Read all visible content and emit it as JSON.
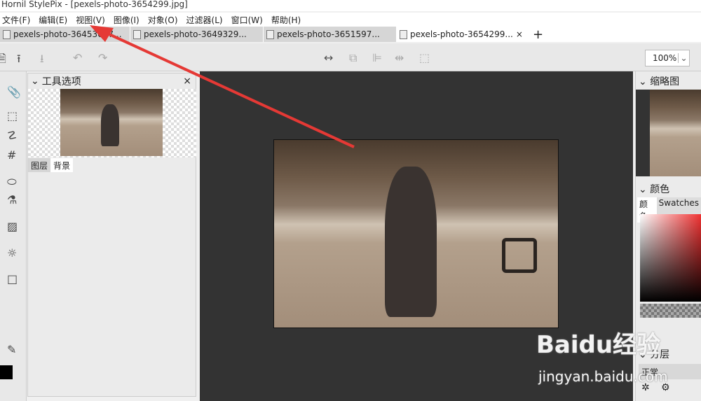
{
  "window_title": "Hornil StylePix - [pexels-photo-3654299.jpg]",
  "menu": [
    "文件(F)",
    "编辑(E)",
    "视图(V)",
    "图像(I)",
    "对象(O)",
    "过滤器(L)",
    "窗口(W)",
    "帮助(H)"
  ],
  "tabs": [
    "pexels-photo-36453697...",
    "pexels-photo-3649329...",
    "pexels-photo-3651597...",
    "pexels-photo-3654299..."
  ],
  "tab_close": "×",
  "tab_add": "+",
  "zoom_value": "100%",
  "tool_options": {
    "title": "工具选项",
    "close": "×",
    "tabs": [
      "图层",
      "背景"
    ]
  },
  "right": {
    "navigator": "缩略图",
    "color": "颜色",
    "color_tabs": [
      "颜色",
      "Swatches"
    ],
    "layers": "分层",
    "blend_mode": "正常"
  },
  "watermark": {
    "brand": "Baidu经验",
    "url": "jingyan.baidu.com"
  },
  "colors": {
    "canvas_bg": "#333333",
    "arrow": "#e53935"
  }
}
